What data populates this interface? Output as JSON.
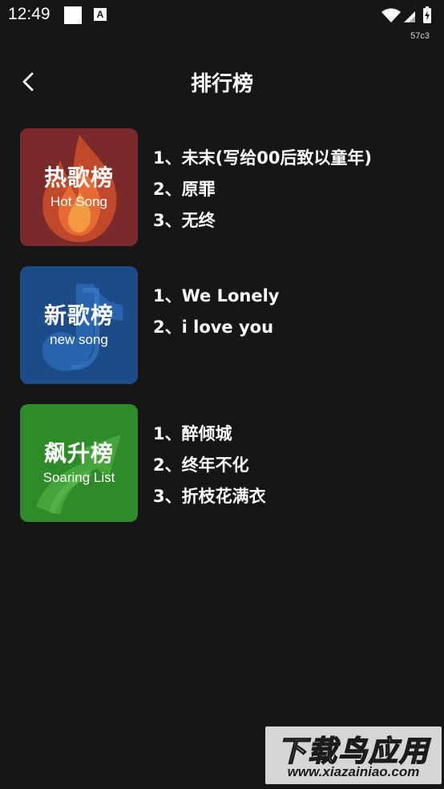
{
  "status_bar": {
    "time": "12:49",
    "build_code": "57c3",
    "notif_badge": "A"
  },
  "header": {
    "title": "排行榜"
  },
  "charts": [
    {
      "cover_title": "热歌榜",
      "cover_subtitle": "Hot Song",
      "color": "#7a2a2a",
      "songs": [
        "1、未末(写给00后致以童年)",
        "2、原罪",
        "3、无终"
      ]
    },
    {
      "cover_title": "新歌榜",
      "cover_subtitle": "new song",
      "color": "#1c4b8a",
      "songs": [
        "1、We Lonely",
        "2、i love you"
      ]
    },
    {
      "cover_title": "飙升榜",
      "cover_subtitle": "Soaring List",
      "color": "#2f8a2a",
      "songs": [
        "1、醉倾城",
        "2、终年不化",
        "3、折枝花满衣"
      ]
    }
  ],
  "watermark": {
    "line1": "下载鸟应用",
    "line2": "www.xiazainiao.com"
  }
}
